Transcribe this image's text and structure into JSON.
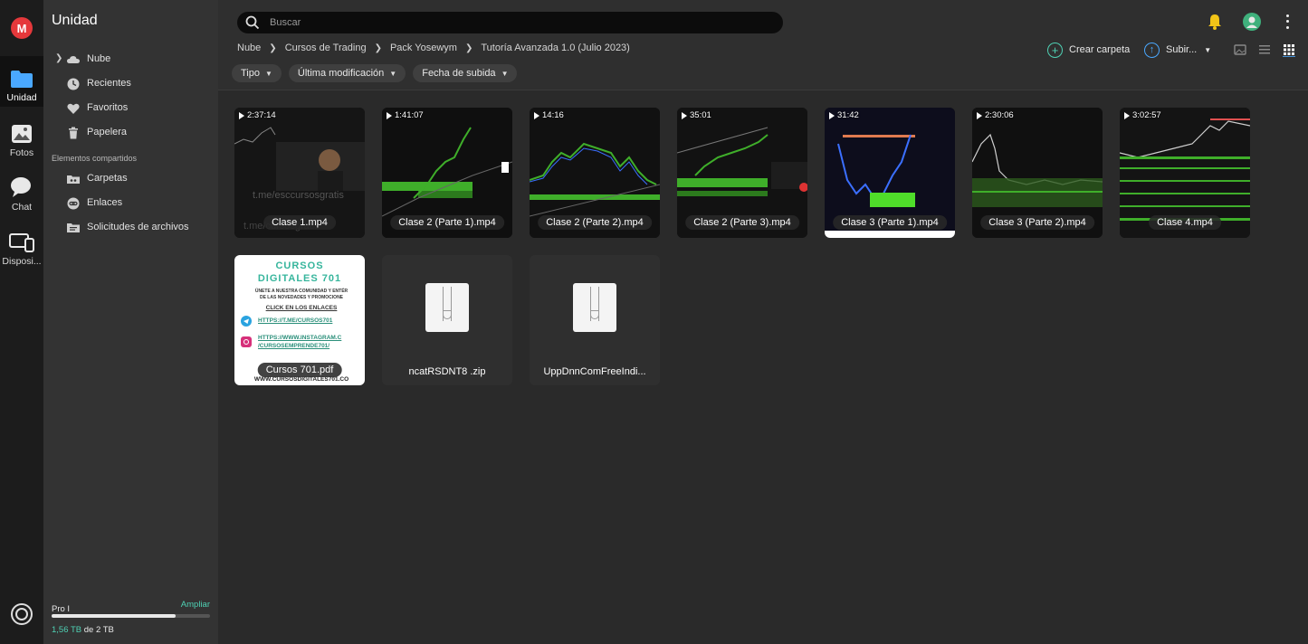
{
  "rail": {
    "items": [
      {
        "label": "Unidad",
        "icon": "folder-icon"
      },
      {
        "label": "Fotos",
        "icon": "photos-icon"
      },
      {
        "label": "Chat",
        "icon": "chat-icon"
      },
      {
        "label": "Disposi...",
        "icon": "devices-icon"
      }
    ],
    "logo": "M"
  },
  "sidebar": {
    "title": "Unidad",
    "items": [
      {
        "label": "Nube",
        "icon": "cloud-icon"
      },
      {
        "label": "Recientes",
        "icon": "clock-icon"
      },
      {
        "label": "Favoritos",
        "icon": "heart-icon"
      },
      {
        "label": "Papelera",
        "icon": "trash-icon"
      }
    ],
    "shared_section": "Elementos compartidos",
    "shared_items": [
      {
        "label": "Carpetas",
        "icon": "shared-folder-icon"
      },
      {
        "label": "Enlaces",
        "icon": "link-icon"
      },
      {
        "label": "Solicitudes de archivos",
        "icon": "file-request-icon"
      }
    ],
    "storage": {
      "plan": "Pro I",
      "upgrade": "Ampliar",
      "used": "1,56 TB",
      "of": "de 2 TB",
      "fraction": 0.78
    }
  },
  "header": {
    "search_placeholder": "Buscar",
    "breadcrumbs": [
      "Nube",
      "Cursos de Trading",
      "Pack Yosewym",
      "Tutoría Avanzada 1.0 (Julio 2023)"
    ],
    "new_folder": "Crear carpeta",
    "upload": "Subir..."
  },
  "filters": [
    "Tipo",
    "Última modificación",
    "Fecha de subida"
  ],
  "files": [
    {
      "name": "Clase 1.mp4",
      "duration": "2:37:14"
    },
    {
      "name": "Clase 2 (Parte 1).mp4",
      "duration": "1:41:07"
    },
    {
      "name": "Clase 2 (Parte 2).mp4",
      "duration": "14:16"
    },
    {
      "name": "Clase 2 (Parte 3).mp4",
      "duration": "35:01"
    },
    {
      "name": "Clase 3 (Parte 1).mp4",
      "duration": "31:42"
    },
    {
      "name": "Clase 3 (Parte 2).mp4",
      "duration": "2:30:06"
    },
    {
      "name": "Clase 4.mp4",
      "duration": "3:02:57"
    },
    {
      "name": "Cursos 701.pdf",
      "duration": ""
    },
    {
      "name": "ncatRSDNT8 .zip",
      "duration": ""
    },
    {
      "name": "UppDnnComFreeIndi...",
      "duration": ""
    }
  ],
  "pdf_preview": {
    "line1": "CURSOS",
    "line2": "DIGITALES 701",
    "line3": "ÚNETE A NUESTRA COMUNIDAD Y ENTÉR",
    "line4": "DE LAS NOVEDADES Y PROMOCIONE",
    "line5": "CLICK EN LOS ENLACES",
    "link1": "HTTPS://T.ME/CURSOS701",
    "link2": "HTTPS://WWW.INSTAGRAM.C",
    "link3": "/CURSOSEMPRENDE701/",
    "footer": "WWW.CURSOSDIGITALES701.CO"
  },
  "colors": {
    "accent": "#4fd1b4",
    "brand": "#e5383b",
    "upload": "#4aa8ff",
    "chart_green": "#3fae2a"
  }
}
